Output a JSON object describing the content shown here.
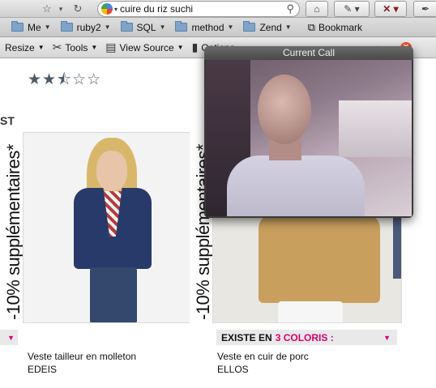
{
  "browser": {
    "url_text": "cuire du riz suchi",
    "bookmarks": [
      {
        "label": "Me"
      },
      {
        "label": "ruby2"
      },
      {
        "label": "SQL"
      },
      {
        "label": "method"
      },
      {
        "label": "Zend"
      },
      {
        "label": "Bookmark"
      }
    ],
    "devbar": {
      "resize": "Resize",
      "tools": "Tools",
      "view_source": "View Source",
      "options": "Options"
    }
  },
  "page": {
    "rating": {
      "stars_filled": 2.5,
      "stars_total": 5,
      "display": "★★⯪☆☆"
    },
    "section_title": "ST",
    "products": [
      {
        "promo": "-10% supplémentaires*",
        "badge_text": "",
        "name": "Veste tailleur en molleton",
        "brand": "EDEIS"
      },
      {
        "promo": "-10% supplémentaires*",
        "badge_text": "EXISTE EN",
        "badge_highlight": "3 COLORIS :",
        "name": "Veste en cuir de porc",
        "brand": "ELLOS"
      }
    ]
  },
  "call_window": {
    "title": "Current Call"
  },
  "colors": {
    "accent_pink": "#d6006f",
    "badge_bg": "#e9e9e9"
  }
}
